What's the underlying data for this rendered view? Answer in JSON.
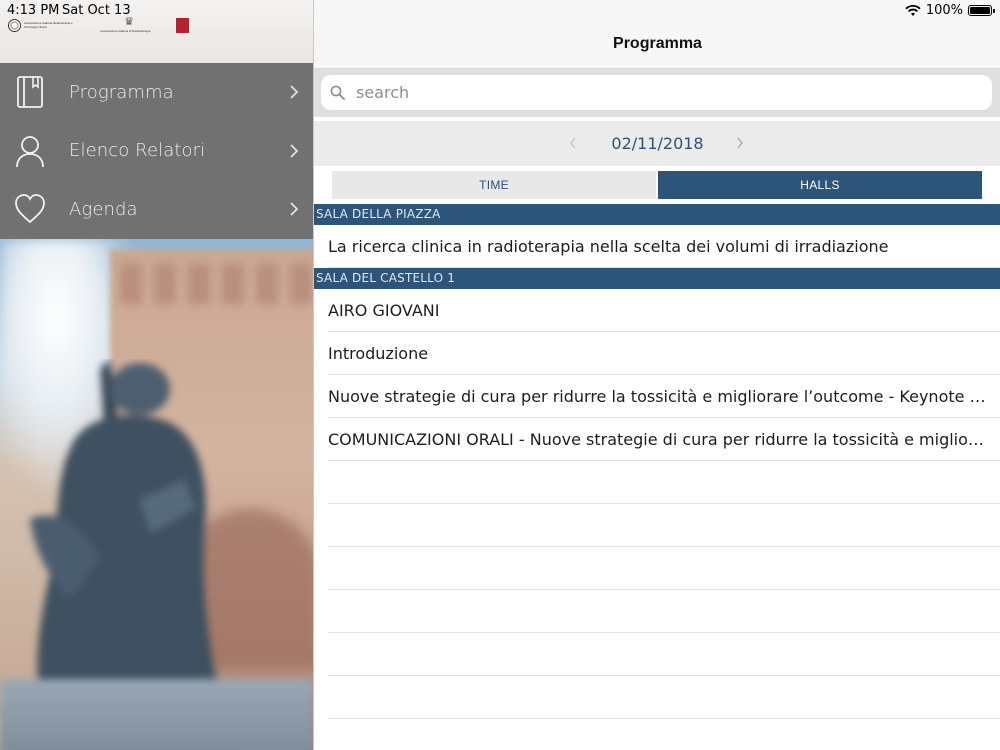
{
  "status_bar": {
    "time": "4:13 PM",
    "date": "Sat Oct 13",
    "battery": "100%"
  },
  "sidebar": {
    "logos": {
      "logo_a_text": "Associazione Italiana Radioterapia e Oncologia clinica",
      "logo_b_text": "Associazione Italiana di Radiobiologia"
    },
    "items": [
      {
        "label": "Programma",
        "icon": "book-icon"
      },
      {
        "label": "Elenco Relatori",
        "icon": "person-icon"
      },
      {
        "label": "Agenda",
        "icon": "heart-icon"
      }
    ]
  },
  "header": {
    "title": "Programma"
  },
  "search": {
    "placeholder": "search",
    "value": ""
  },
  "date_nav": {
    "date": "02/11/2018"
  },
  "segments": {
    "time_label": "TIME",
    "halls_label": "HALLS",
    "selected": "HALLS"
  },
  "sections": [
    {
      "header": "SALA DELLA PIAZZA",
      "rows": [
        "La ricerca clinica in radioterapia nella scelta dei volumi di irradiazione"
      ]
    },
    {
      "header": "SALA DEL CASTELLO 1",
      "rows": [
        "AIRO GIOVANI",
        "Introduzione",
        "Nuove strategie di cura per ridurre la tossicità e migliorare l’outcome - Keynote Lecture",
        "COMUNICAZIONI ORALI - Nuove strategie di cura per ridurre la tossicità e migliorare l’outcome"
      ]
    }
  ],
  "colors": {
    "accent": "#2d5479",
    "sidebar_bg": "#717171",
    "date_text": "#2f5176"
  }
}
